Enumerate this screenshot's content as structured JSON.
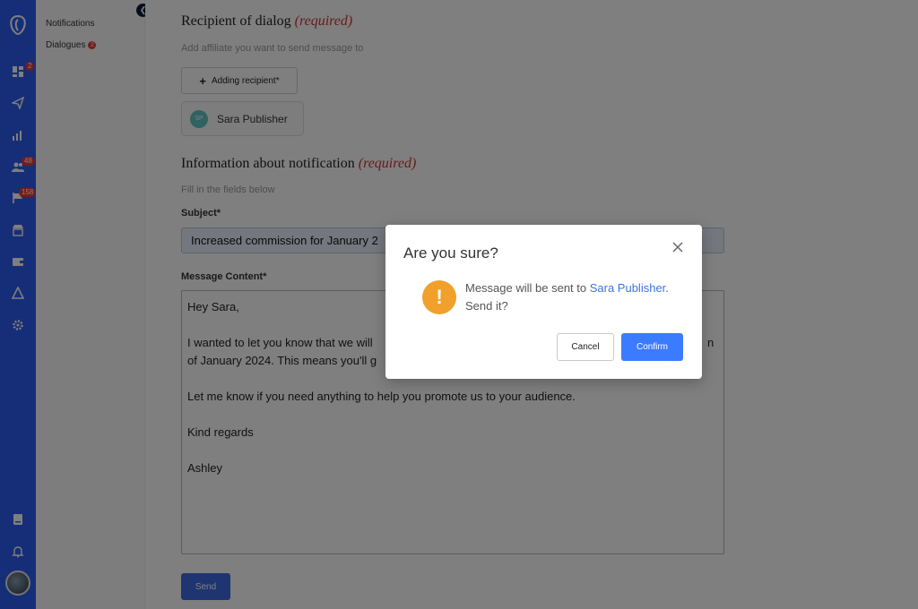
{
  "subnav": {
    "items": [
      {
        "label": "Notifications",
        "badge": ""
      },
      {
        "label": "Dialogues",
        "badge": "2"
      }
    ]
  },
  "rail": {
    "badges": {
      "dashboard": "2",
      "partners": "48",
      "flags": "158"
    },
    "icons": [
      "logo-icon",
      "dashboard-icon",
      "send-icon",
      "chart-icon",
      "users-icon",
      "flag-icon",
      "store-icon",
      "wallet-icon",
      "triangle-icon",
      "gear-icon",
      "book-icon",
      "bell-icon",
      "user-avatar"
    ]
  },
  "recipient": {
    "heading": "Recipient of dialog",
    "required": "(required)",
    "hint": "Add affiliate you want to send message to",
    "add_label": "Adding recipient*",
    "chip_initials": "SP",
    "chip_name": "Sara Publisher"
  },
  "info": {
    "heading": "Information about notification",
    "required": "(required)",
    "hint": "Fill in the fields below",
    "subject_label": "Subject*",
    "subject_value": "Increased commission for January 2",
    "message_label": "Message Content*",
    "message_lines": [
      "Hey Sara,",
      "I wanted to let you know that we will",
      "of January 2024. This means you'll g",
      "Let me know if you need anything to help you promote us to your audience.",
      "Kind regards",
      "Ashley"
    ],
    "message_right_fragment": "n",
    "send_label": "Send"
  },
  "modal": {
    "title": "Are you sure?",
    "body_prefix": "Message will be sent to ",
    "body_link": "Sara Publisher",
    "body_suffix": ". Send it?",
    "cancel_label": "Cancel",
    "confirm_label": "Confirm"
  },
  "colors": {
    "rail": "#2c5cf0",
    "primary": "#3b7bff",
    "required": "#d23333",
    "warning": "#f0a02b",
    "badge": "#e43b3b"
  }
}
